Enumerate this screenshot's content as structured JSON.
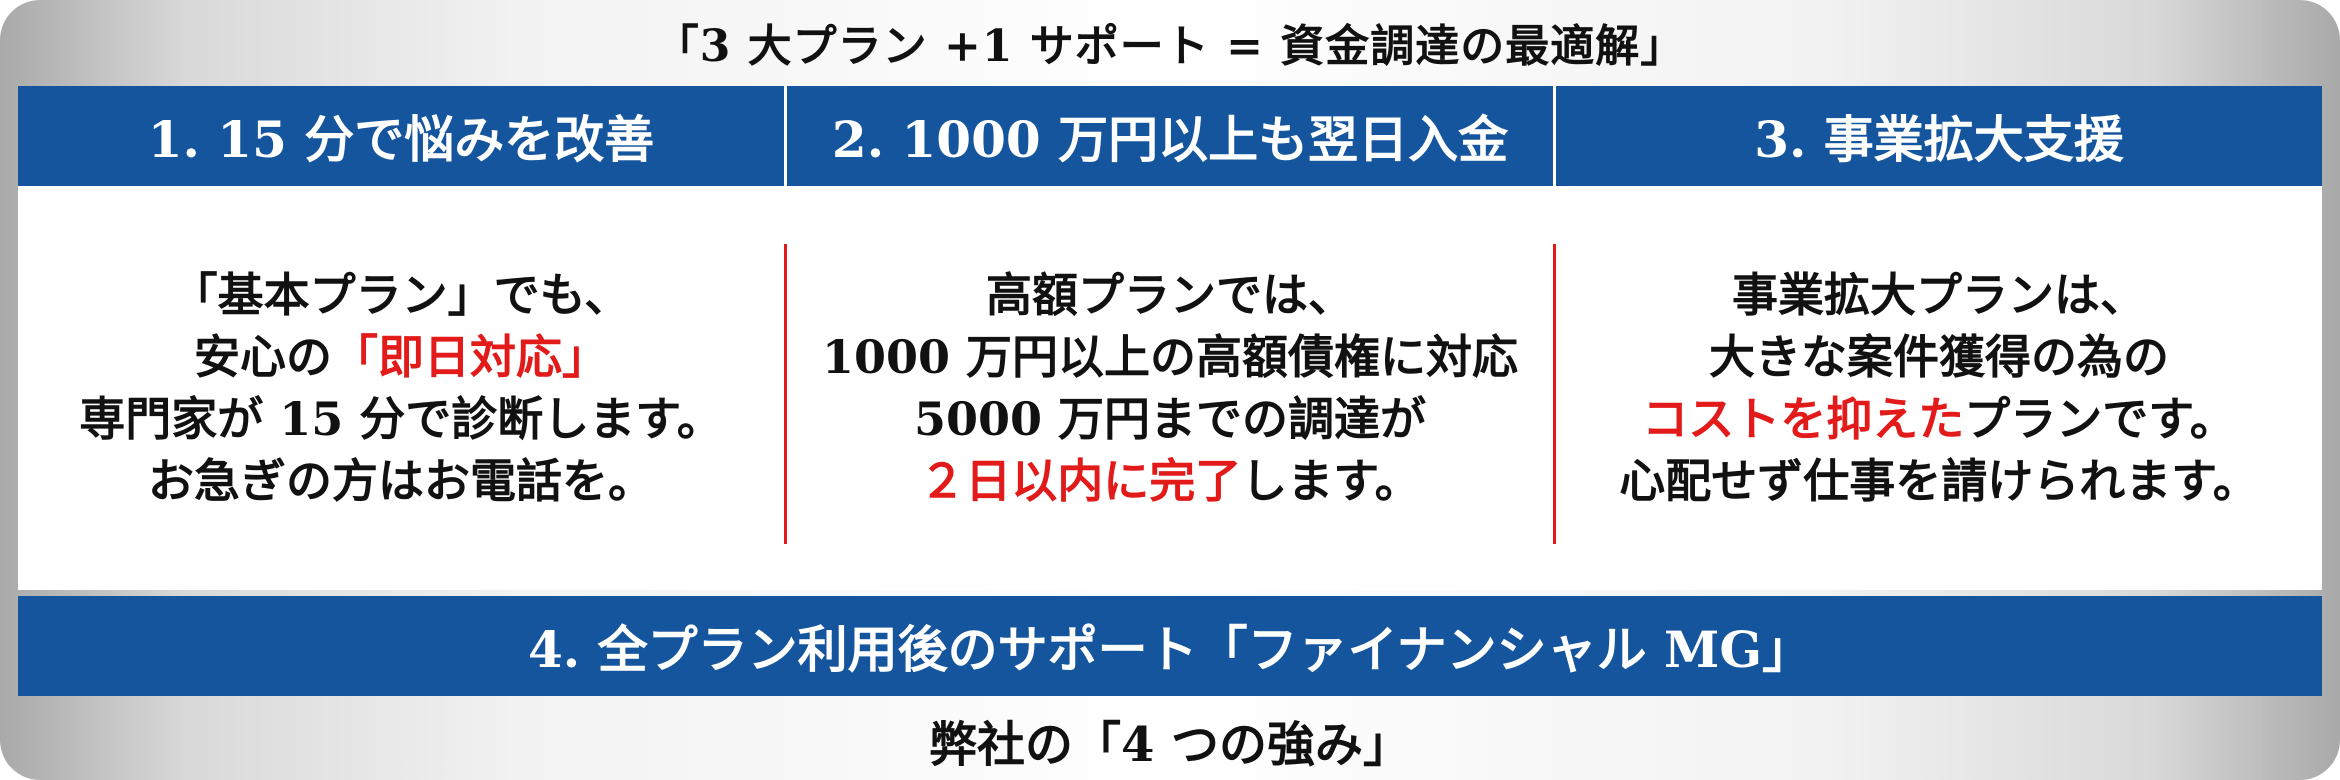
{
  "top_title": "「3 大プラン +1 サポート = 資金調達の最適解」",
  "headers": [
    "1. 15 分で悩みを改善",
    "2. 1000 万円以上も翌日入金",
    "3. 事業拡大支援"
  ],
  "columns": [
    {
      "lines": [
        [
          {
            "t": "「基本プラン」でも、"
          }
        ],
        [
          {
            "t": "安心の"
          },
          {
            "t": "「即日対応」",
            "red": true
          }
        ],
        [
          {
            "t": "専門家が 15 分で診断します。"
          }
        ],
        [
          {
            "t": "お急ぎの方はお電話を。"
          }
        ]
      ]
    },
    {
      "lines": [
        [
          {
            "t": "高額プランでは、"
          }
        ],
        [
          {
            "t": "1000 万円以上の高額債権に対応"
          }
        ],
        [
          {
            "t": "5000 万円までの調達が"
          }
        ],
        [
          {
            "t": "２日以内に完了",
            "red": true
          },
          {
            "t": "します。"
          }
        ]
      ]
    },
    {
      "lines": [
        [
          {
            "t": "事業拡大プランは、"
          }
        ],
        [
          {
            "t": "大きな案件獲得の為の"
          }
        ],
        [
          {
            "t": "コストを抑えた",
            "red": true
          },
          {
            "t": "プランです。"
          }
        ],
        [
          {
            "t": "心配せず仕事を請けられます。"
          }
        ]
      ]
    }
  ],
  "footer_bar": "4. 全プラン利用後のサポート「ファイナンシャル MG」",
  "bottom_title": "弊社の「4 つの強み」",
  "colors": {
    "blue": "#14559d",
    "red": "#e21a1a"
  }
}
